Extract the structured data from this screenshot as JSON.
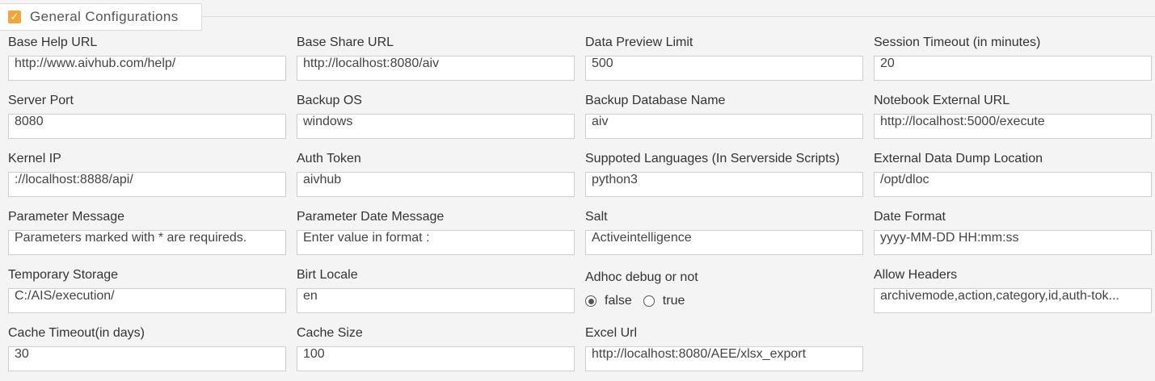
{
  "section": {
    "title": "General Configurations",
    "checked": true,
    "accent_color": "#f3a43b"
  },
  "fields": {
    "base_help_url": {
      "label": "Base Help URL",
      "value": "http://www.aivhub.com/help/"
    },
    "base_share_url": {
      "label": "Base Share URL",
      "value": "http://localhost:8080/aiv"
    },
    "data_preview_limit": {
      "label": "Data Preview Limit",
      "value": "500"
    },
    "session_timeout": {
      "label": "Session Timeout (in minutes)",
      "value": "20"
    },
    "server_port": {
      "label": "Server Port",
      "value": "8080"
    },
    "backup_os": {
      "label": "Backup OS",
      "value": "windows"
    },
    "backup_db_name": {
      "label": "Backup Database Name",
      "value": "aiv"
    },
    "notebook_external_url": {
      "label": "Notebook External URL",
      "value": "http://localhost:5000/execute"
    },
    "kernel_ip": {
      "label": "Kernel IP",
      "value": "://localhost:8888/api/"
    },
    "auth_token": {
      "label": "Auth Token",
      "value": "aivhub"
    },
    "supported_languages": {
      "label": "Suppoted Languages (In Serverside Scripts)",
      "value": "python3"
    },
    "external_data_dump": {
      "label": "External Data Dump Location",
      "value": "/opt/dloc"
    },
    "parameter_message": {
      "label": "Parameter Message",
      "value": "Parameters marked with * are requireds."
    },
    "parameter_date_message": {
      "label": "Parameter Date Message",
      "value": "Enter value in format :"
    },
    "salt": {
      "label": "Salt",
      "value": "Activeintelligence"
    },
    "date_format": {
      "label": "Date Format",
      "value": "yyyy-MM-DD HH:mm:ss"
    },
    "temporary_storage": {
      "label": "Temporary Storage",
      "value": "C:/AIS/execution/"
    },
    "birt_locale": {
      "label": "Birt Locale",
      "value": "en"
    },
    "adhoc_debug": {
      "label": "Adhoc debug or not",
      "options": [
        "false",
        "true"
      ],
      "selected": "false"
    },
    "allow_headers": {
      "label": "Allow Headers",
      "value": "archivemode,action,category,id,auth-tok..."
    },
    "cache_timeout": {
      "label": "Cache Timeout(in days)",
      "value": "30"
    },
    "cache_size": {
      "label": "Cache Size",
      "value": "100"
    },
    "excel_url": {
      "label": "Excel Url",
      "value": "http://localhost:8080/AEE/xlsx_export"
    }
  }
}
